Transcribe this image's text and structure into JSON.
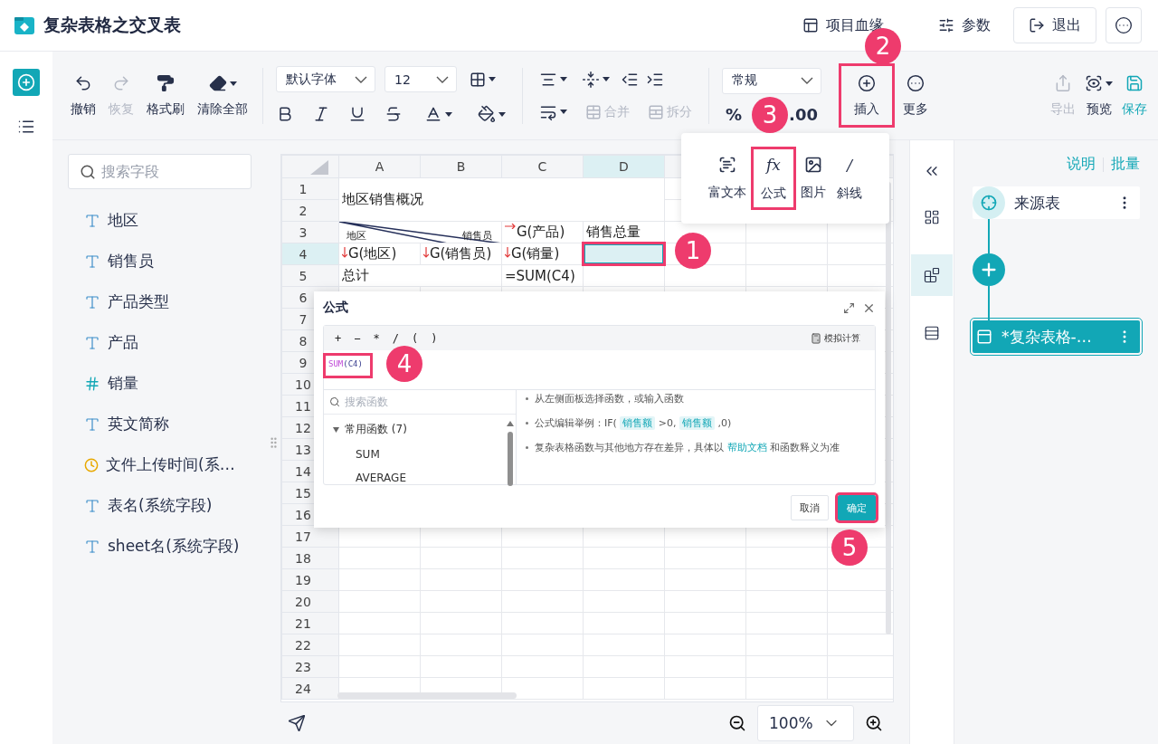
{
  "app": {
    "title": "复杂表格之交叉表"
  },
  "header_actions": [
    {
      "kind": "link",
      "label": "项目血缘"
    },
    {
      "kind": "link",
      "label": "参数"
    },
    {
      "kind": "button",
      "label": "退出"
    },
    {
      "kind": "menu"
    }
  ],
  "toolbar": {
    "history": [
      {
        "label": "撤销",
        "disabled": false
      },
      {
        "label": "恢复",
        "disabled": true
      },
      {
        "label": "格式刷",
        "disabled": false
      },
      {
        "label": "清除全部",
        "disabled": false
      }
    ],
    "font_family": "默认字体",
    "font_size": "12",
    "merge": [
      {
        "label": "合并",
        "disabled": true
      },
      {
        "label": "拆分",
        "disabled": true
      }
    ],
    "number_format": "常规",
    "percent": "%",
    "decimals": ".00",
    "insert": {
      "label": "插入",
      "highlighted": true
    },
    "more": "更多",
    "output": [
      {
        "label": "导出",
        "disabled": true,
        "primary": false
      },
      {
        "label": "预览",
        "disabled": false,
        "primary": false
      },
      {
        "label": "保存",
        "disabled": false,
        "primary": true
      }
    ]
  },
  "insert_menu": [
    {
      "label": "富文本",
      "highlighted": false
    },
    {
      "label": "公式",
      "glyph": "fx",
      "highlighted": true
    },
    {
      "label": "图片",
      "highlighted": false
    },
    {
      "label": "斜线",
      "glyph": "/",
      "highlighted": false
    }
  ],
  "fields": {
    "search_placeholder": "搜索字段",
    "items": [
      {
        "name": "地区",
        "kind": "text"
      },
      {
        "name": "销售员",
        "kind": "text"
      },
      {
        "name": "产品类型",
        "kind": "text"
      },
      {
        "name": "产品",
        "kind": "text"
      },
      {
        "name": "销量",
        "kind": "number"
      },
      {
        "name": "英文简称",
        "kind": "text"
      },
      {
        "name": "文件上传时间(系…",
        "kind": "time"
      },
      {
        "name": "表名(系统字段)",
        "kind": "text"
      },
      {
        "name": "sheet名(系统字段)",
        "kind": "text"
      }
    ]
  },
  "sheet": {
    "columns": [
      {
        "label": "A",
        "selected": false
      },
      {
        "label": "B",
        "selected": false
      },
      {
        "label": "C",
        "selected": false
      },
      {
        "label": "D",
        "selected": true
      }
    ],
    "rows": [
      {
        "label": "1",
        "selected": false
      },
      {
        "label": "2",
        "selected": false
      },
      {
        "label": "3",
        "selected": false
      },
      {
        "label": "4",
        "selected": true
      },
      {
        "label": "5",
        "selected": false
      },
      {
        "label": "6",
        "selected": false
      },
      {
        "label": "7",
        "selected": false
      },
      {
        "label": "8",
        "selected": false
      },
      {
        "label": "9",
        "selected": false
      },
      {
        "label": "10",
        "selected": false
      },
      {
        "label": "11",
        "selected": false
      },
      {
        "label": "12",
        "selected": false
      },
      {
        "label": "13",
        "selected": false
      },
      {
        "label": "14",
        "selected": false
      },
      {
        "label": "15",
        "selected": false
      },
      {
        "label": "16",
        "selected": false
      },
      {
        "label": "17",
        "selected": false
      },
      {
        "label": "18",
        "selected": false
      },
      {
        "label": "19",
        "selected": false
      },
      {
        "label": "20",
        "selected": false
      },
      {
        "label": "21",
        "selected": false
      },
      {
        "label": "22",
        "selected": false
      },
      {
        "label": "23",
        "selected": false
      },
      {
        "label": "24",
        "selected": false
      }
    ],
    "title": "地区销售概况",
    "corner_labels": [
      "地区",
      "销售员"
    ],
    "row3": [
      {
        "text": "G(产品)",
        "expand_right": true,
        "expand_down": false
      },
      {
        "text": "销售总量",
        "expand_right": false,
        "expand_down": false
      }
    ],
    "row4": [
      {
        "text": "G(地区)",
        "expand_right": false,
        "expand_down": true
      },
      {
        "text": "G(销售员)",
        "expand_right": false,
        "expand_down": true
      },
      {
        "text": "G(销量)",
        "expand_right": false,
        "expand_down": true
      }
    ],
    "active_cell": {
      "highlighted": true
    },
    "total_label": "总计",
    "total_formula": "=SUM(C4)"
  },
  "formula_dialog": {
    "title": "公式",
    "operators": [
      "+",
      "−",
      "*",
      "/",
      "(",
      ")"
    ],
    "simulate": "模拟计算",
    "formula_function": "SUM",
    "formula_args": "(C4)",
    "formula_highlighted": true,
    "search_placeholder": "搜索函数",
    "categories": [
      {
        "label": "常用函数 (7)",
        "expanded": true,
        "children": [
          "SUM",
          "AVERAGE"
        ]
      }
    ],
    "hints": [
      [
        {
          "kind": "text",
          "text": "从左侧面板选择函数，或输入函数"
        }
      ],
      [
        {
          "kind": "text",
          "text": "公式编辑举例：IF( "
        },
        {
          "kind": "tag",
          "text": "销售额"
        },
        {
          "kind": "text",
          "text": " >0, "
        },
        {
          "kind": "tag",
          "text": "销售额"
        },
        {
          "kind": "text",
          "text": " ,0)"
        }
      ],
      [
        {
          "kind": "text",
          "text": "复杂表格函数与其他地方存在差异，具体以 "
        },
        {
          "kind": "link",
          "text": "帮助文档"
        },
        {
          "kind": "text",
          "text": " 和函数释义为准"
        }
      ]
    ],
    "cancel": "取消",
    "confirm": {
      "label": "确定",
      "highlighted": true
    }
  },
  "side_tabs": [
    {
      "selected": false
    },
    {
      "selected": true
    },
    {
      "selected": false
    }
  ],
  "right_panel": {
    "links": [
      "说明",
      "批量"
    ],
    "nodes": [
      {
        "kind": "source",
        "label": "来源表"
      },
      {
        "kind": "add"
      },
      {
        "kind": "output",
        "label": "*复杂表格-…",
        "selected": true
      }
    ]
  },
  "zoom": "100%",
  "annotations": [
    {
      "number": "1"
    },
    {
      "number": "2"
    },
    {
      "number": "3"
    },
    {
      "number": "4"
    },
    {
      "number": "5"
    }
  ]
}
